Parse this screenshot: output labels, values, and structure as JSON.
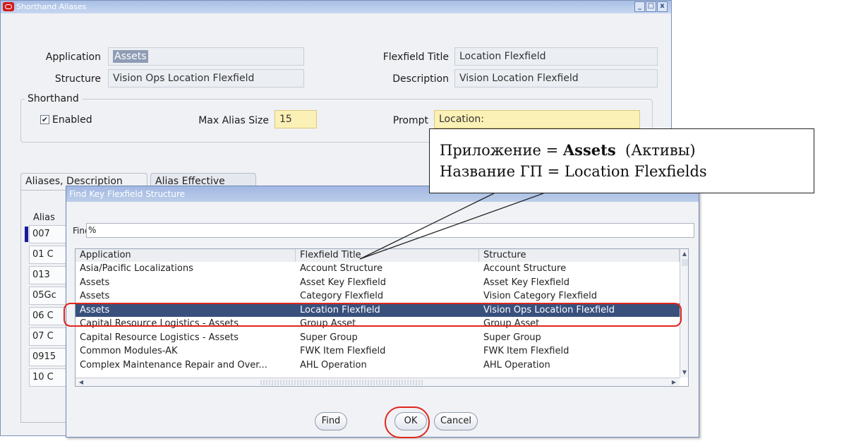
{
  "main_window": {
    "title": "Shorthand Aliases",
    "buttons": {
      "minimize": "_",
      "maximize": "□",
      "close": "x"
    },
    "fields": {
      "application": {
        "label": "Application",
        "value": "Assets"
      },
      "flexfield_title": {
        "label": "Flexfield Title",
        "value": "Location Flexfield"
      },
      "structure": {
        "label": "Structure",
        "value": "Vision Ops Location Flexfield"
      },
      "description": {
        "label": "Description",
        "value": "Vision Location Flexfield"
      }
    },
    "shorthand": {
      "legend": "Shorthand",
      "enabled_label": "Enabled",
      "enabled_checked": true,
      "max_alias_size_label": "Max Alias Size",
      "max_alias_size_value": "15",
      "prompt_label": "Prompt",
      "prompt_value": "Location:"
    },
    "tabs": [
      "Aliases, Description",
      "Alias Effective"
    ],
    "alias_column_header": "Alias",
    "alias_rows": [
      "007",
      "01 C",
      "013",
      "05Gc",
      "06 C",
      "07 C",
      "0915",
      "10 C"
    ]
  },
  "dialog": {
    "title": "Find Key Flexfield Structure",
    "find_label": "Find",
    "find_value": "%",
    "columns": [
      "Application",
      "Flexfield Title",
      "Structure"
    ],
    "rows": [
      {
        "application": "Asia/Pacific Localizations",
        "flexfield_title": "Account Structure",
        "structure": "Account Structure"
      },
      {
        "application": "Assets",
        "flexfield_title": "Asset Key Flexfield",
        "structure": "Asset Key Flexfield"
      },
      {
        "application": "Assets",
        "flexfield_title": "Category Flexfield",
        "structure": "Vision Category Flexfield"
      },
      {
        "application": "Assets",
        "flexfield_title": "Location Flexfield",
        "structure": "Vision Ops Location Flexfield",
        "selected": true
      },
      {
        "application": "Capital Resource Logistics - Assets",
        "flexfield_title": "Group Asset",
        "structure": "Group Asset"
      },
      {
        "application": "Capital Resource Logistics - Assets",
        "flexfield_title": "Super Group",
        "structure": "Super Group"
      },
      {
        "application": "Common Modules-AK",
        "flexfield_title": "FWK Item Flexfield",
        "structure": "FWK Item Flexfield"
      },
      {
        "application": "Complex Maintenance Repair and Over...",
        "flexfield_title": "AHL Operation",
        "structure": "AHL Operation"
      }
    ],
    "buttons": {
      "find": "Find",
      "ok": "OK",
      "cancel": "Cancel"
    }
  },
  "callout": {
    "line1_prefix": "Приложение = ",
    "line1_bold": "Assets",
    "line1_suffix": "  (Активы)",
    "line2": "Название ГП = Location Flexfields"
  },
  "colors": {
    "selection": "#39507d",
    "annotation_red": "#e0261e",
    "titlebar": "#a8bfe6",
    "required_field": "#fbf0b5"
  }
}
